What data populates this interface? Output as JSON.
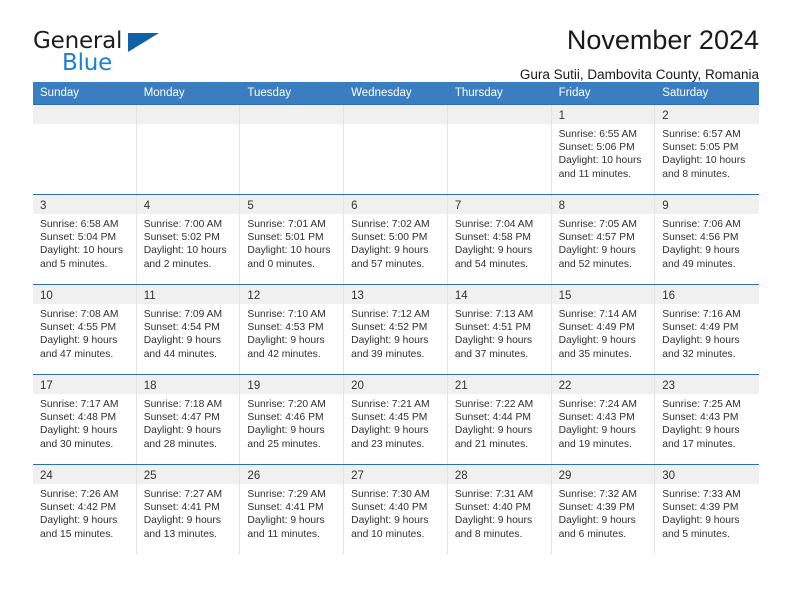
{
  "brand": {
    "word_one": "General",
    "word_two": "Blue",
    "mark": "triangle-logo"
  },
  "header": {
    "title": "November 2024",
    "subtitle": "Gura Sutii, Dambovita County, Romania"
  },
  "calendar": {
    "weekdays": [
      "Sunday",
      "Monday",
      "Tuesday",
      "Wednesday",
      "Thursday",
      "Friday",
      "Saturday"
    ],
    "accent_color": "#3a7dc0",
    "row_border_color": "#2f6fb0",
    "day_band_color": "#f0f0f0",
    "weeks": [
      [
        {
          "day": "",
          "sunrise": "",
          "sunset": "",
          "daylight_line1": "",
          "daylight_line2": "",
          "empty": true
        },
        {
          "day": "",
          "sunrise": "",
          "sunset": "",
          "daylight_line1": "",
          "daylight_line2": "",
          "empty": true
        },
        {
          "day": "",
          "sunrise": "",
          "sunset": "",
          "daylight_line1": "",
          "daylight_line2": "",
          "empty": true
        },
        {
          "day": "",
          "sunrise": "",
          "sunset": "",
          "daylight_line1": "",
          "daylight_line2": "",
          "empty": true
        },
        {
          "day": "",
          "sunrise": "",
          "sunset": "",
          "daylight_line1": "",
          "daylight_line2": "",
          "empty": true
        },
        {
          "day": "1",
          "sunrise": "Sunrise: 6:55 AM",
          "sunset": "Sunset: 5:06 PM",
          "daylight_line1": "Daylight: 10 hours",
          "daylight_line2": "and 11 minutes.",
          "empty": false
        },
        {
          "day": "2",
          "sunrise": "Sunrise: 6:57 AM",
          "sunset": "Sunset: 5:05 PM",
          "daylight_line1": "Daylight: 10 hours",
          "daylight_line2": "and 8 minutes.",
          "empty": false
        }
      ],
      [
        {
          "day": "3",
          "sunrise": "Sunrise: 6:58 AM",
          "sunset": "Sunset: 5:04 PM",
          "daylight_line1": "Daylight: 10 hours",
          "daylight_line2": "and 5 minutes.",
          "empty": false
        },
        {
          "day": "4",
          "sunrise": "Sunrise: 7:00 AM",
          "sunset": "Sunset: 5:02 PM",
          "daylight_line1": "Daylight: 10 hours",
          "daylight_line2": "and 2 minutes.",
          "empty": false
        },
        {
          "day": "5",
          "sunrise": "Sunrise: 7:01 AM",
          "sunset": "Sunset: 5:01 PM",
          "daylight_line1": "Daylight: 10 hours",
          "daylight_line2": "and 0 minutes.",
          "empty": false
        },
        {
          "day": "6",
          "sunrise": "Sunrise: 7:02 AM",
          "sunset": "Sunset: 5:00 PM",
          "daylight_line1": "Daylight: 9 hours",
          "daylight_line2": "and 57 minutes.",
          "empty": false
        },
        {
          "day": "7",
          "sunrise": "Sunrise: 7:04 AM",
          "sunset": "Sunset: 4:58 PM",
          "daylight_line1": "Daylight: 9 hours",
          "daylight_line2": "and 54 minutes.",
          "empty": false
        },
        {
          "day": "8",
          "sunrise": "Sunrise: 7:05 AM",
          "sunset": "Sunset: 4:57 PM",
          "daylight_line1": "Daylight: 9 hours",
          "daylight_line2": "and 52 minutes.",
          "empty": false
        },
        {
          "day": "9",
          "sunrise": "Sunrise: 7:06 AM",
          "sunset": "Sunset: 4:56 PM",
          "daylight_line1": "Daylight: 9 hours",
          "daylight_line2": "and 49 minutes.",
          "empty": false
        }
      ],
      [
        {
          "day": "10",
          "sunrise": "Sunrise: 7:08 AM",
          "sunset": "Sunset: 4:55 PM",
          "daylight_line1": "Daylight: 9 hours",
          "daylight_line2": "and 47 minutes.",
          "empty": false
        },
        {
          "day": "11",
          "sunrise": "Sunrise: 7:09 AM",
          "sunset": "Sunset: 4:54 PM",
          "daylight_line1": "Daylight: 9 hours",
          "daylight_line2": "and 44 minutes.",
          "empty": false
        },
        {
          "day": "12",
          "sunrise": "Sunrise: 7:10 AM",
          "sunset": "Sunset: 4:53 PM",
          "daylight_line1": "Daylight: 9 hours",
          "daylight_line2": "and 42 minutes.",
          "empty": false
        },
        {
          "day": "13",
          "sunrise": "Sunrise: 7:12 AM",
          "sunset": "Sunset: 4:52 PM",
          "daylight_line1": "Daylight: 9 hours",
          "daylight_line2": "and 39 minutes.",
          "empty": false
        },
        {
          "day": "14",
          "sunrise": "Sunrise: 7:13 AM",
          "sunset": "Sunset: 4:51 PM",
          "daylight_line1": "Daylight: 9 hours",
          "daylight_line2": "and 37 minutes.",
          "empty": false
        },
        {
          "day": "15",
          "sunrise": "Sunrise: 7:14 AM",
          "sunset": "Sunset: 4:49 PM",
          "daylight_line1": "Daylight: 9 hours",
          "daylight_line2": "and 35 minutes.",
          "empty": false
        },
        {
          "day": "16",
          "sunrise": "Sunrise: 7:16 AM",
          "sunset": "Sunset: 4:49 PM",
          "daylight_line1": "Daylight: 9 hours",
          "daylight_line2": "and 32 minutes.",
          "empty": false
        }
      ],
      [
        {
          "day": "17",
          "sunrise": "Sunrise: 7:17 AM",
          "sunset": "Sunset: 4:48 PM",
          "daylight_line1": "Daylight: 9 hours",
          "daylight_line2": "and 30 minutes.",
          "empty": false
        },
        {
          "day": "18",
          "sunrise": "Sunrise: 7:18 AM",
          "sunset": "Sunset: 4:47 PM",
          "daylight_line1": "Daylight: 9 hours",
          "daylight_line2": "and 28 minutes.",
          "empty": false
        },
        {
          "day": "19",
          "sunrise": "Sunrise: 7:20 AM",
          "sunset": "Sunset: 4:46 PM",
          "daylight_line1": "Daylight: 9 hours",
          "daylight_line2": "and 25 minutes.",
          "empty": false
        },
        {
          "day": "20",
          "sunrise": "Sunrise: 7:21 AM",
          "sunset": "Sunset: 4:45 PM",
          "daylight_line1": "Daylight: 9 hours",
          "daylight_line2": "and 23 minutes.",
          "empty": false
        },
        {
          "day": "21",
          "sunrise": "Sunrise: 7:22 AM",
          "sunset": "Sunset: 4:44 PM",
          "daylight_line1": "Daylight: 9 hours",
          "daylight_line2": "and 21 minutes.",
          "empty": false
        },
        {
          "day": "22",
          "sunrise": "Sunrise: 7:24 AM",
          "sunset": "Sunset: 4:43 PM",
          "daylight_line1": "Daylight: 9 hours",
          "daylight_line2": "and 19 minutes.",
          "empty": false
        },
        {
          "day": "23",
          "sunrise": "Sunrise: 7:25 AM",
          "sunset": "Sunset: 4:43 PM",
          "daylight_line1": "Daylight: 9 hours",
          "daylight_line2": "and 17 minutes.",
          "empty": false
        }
      ],
      [
        {
          "day": "24",
          "sunrise": "Sunrise: 7:26 AM",
          "sunset": "Sunset: 4:42 PM",
          "daylight_line1": "Daylight: 9 hours",
          "daylight_line2": "and 15 minutes.",
          "empty": false
        },
        {
          "day": "25",
          "sunrise": "Sunrise: 7:27 AM",
          "sunset": "Sunset: 4:41 PM",
          "daylight_line1": "Daylight: 9 hours",
          "daylight_line2": "and 13 minutes.",
          "empty": false
        },
        {
          "day": "26",
          "sunrise": "Sunrise: 7:29 AM",
          "sunset": "Sunset: 4:41 PM",
          "daylight_line1": "Daylight: 9 hours",
          "daylight_line2": "and 11 minutes.",
          "empty": false
        },
        {
          "day": "27",
          "sunrise": "Sunrise: 7:30 AM",
          "sunset": "Sunset: 4:40 PM",
          "daylight_line1": "Daylight: 9 hours",
          "daylight_line2": "and 10 minutes.",
          "empty": false
        },
        {
          "day": "28",
          "sunrise": "Sunrise: 7:31 AM",
          "sunset": "Sunset: 4:40 PM",
          "daylight_line1": "Daylight: 9 hours",
          "daylight_line2": "and 8 minutes.",
          "empty": false
        },
        {
          "day": "29",
          "sunrise": "Sunrise: 7:32 AM",
          "sunset": "Sunset: 4:39 PM",
          "daylight_line1": "Daylight: 9 hours",
          "daylight_line2": "and 6 minutes.",
          "empty": false
        },
        {
          "day": "30",
          "sunrise": "Sunrise: 7:33 AM",
          "sunset": "Sunset: 4:39 PM",
          "daylight_line1": "Daylight: 9 hours",
          "daylight_line2": "and 5 minutes.",
          "empty": false
        }
      ]
    ]
  }
}
